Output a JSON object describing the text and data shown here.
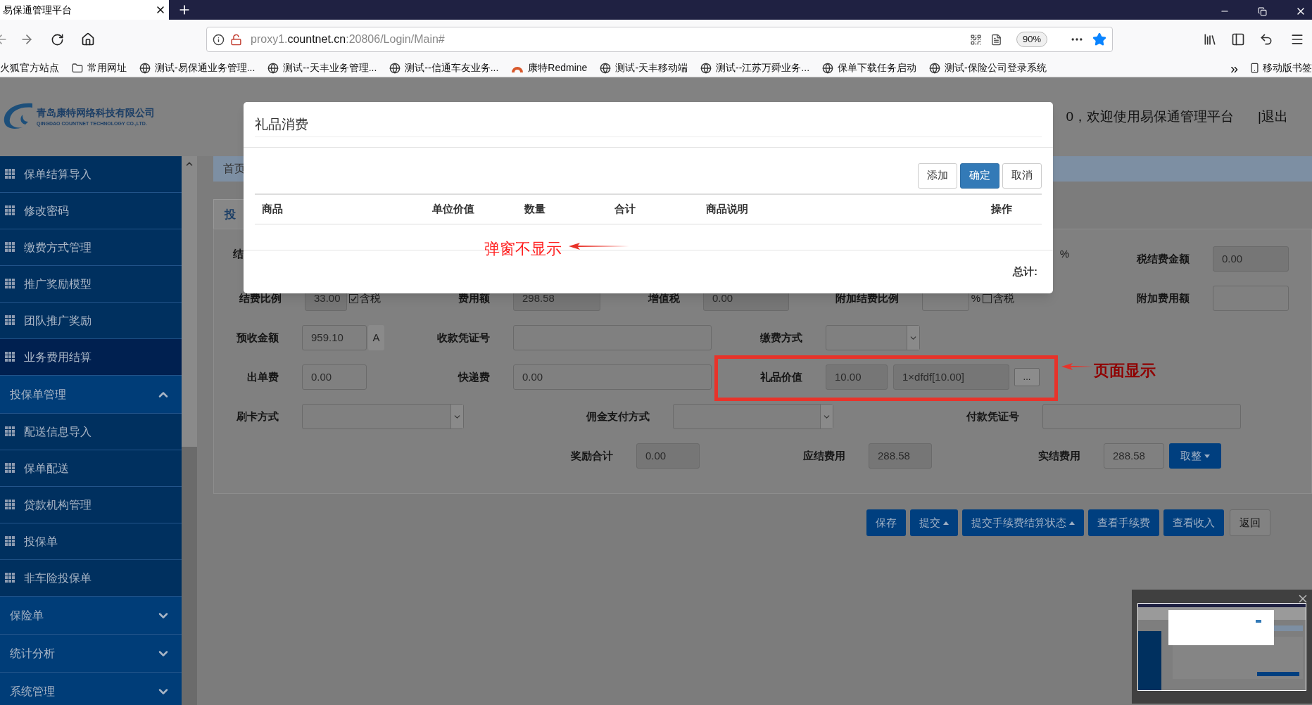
{
  "browser": {
    "tab_title": "易保通管理平台",
    "url_prefix": "proxy1.",
    "url_domain": "countnet.cn",
    "url_path": ":20806/Login/Main#",
    "zoom": "90%",
    "bookmarks": [
      {
        "label": "火狐官方站点",
        "kind": "none"
      },
      {
        "label": "常用网址",
        "kind": "folder"
      },
      {
        "label": "测试-易保通业务管理...",
        "kind": "globe"
      },
      {
        "label": "测试--天丰业务管理...",
        "kind": "globe"
      },
      {
        "label": "测试--信通车友业务...",
        "kind": "globe"
      },
      {
        "label": "康特Redmine",
        "kind": "redmine"
      },
      {
        "label": "测试-天丰移动端",
        "kind": "globe"
      },
      {
        "label": "测试--江苏万舜业务...",
        "kind": "globe"
      },
      {
        "label": "保单下载任务启动",
        "kind": "globe"
      },
      {
        "label": "测试-保险公司登录系统",
        "kind": "globe"
      }
    ],
    "overflow": "»",
    "mobile_bookmarks": "移动版书签"
  },
  "header": {
    "company_name": "青岛康特网络科技有限公司",
    "company_english": "QINGDAO COUNTNET TECHNOLOGY CO.,LTD.",
    "welcome": "0，欢迎使用易保通管理平台",
    "logout": "|退出"
  },
  "sidebar": {
    "items": [
      {
        "label": "保单结算导入",
        "kind": "item",
        "selected": false
      },
      {
        "label": "修改密码",
        "kind": "item",
        "selected": false
      },
      {
        "label": "缴费方式管理",
        "kind": "item",
        "selected": false
      },
      {
        "label": "推广奖励模型",
        "kind": "item",
        "selected": false
      },
      {
        "label": "团队推广奖励",
        "kind": "item",
        "selected": false
      },
      {
        "label": "业务费用结算",
        "kind": "item",
        "selected": true
      },
      {
        "label": "投保单管理",
        "kind": "group",
        "expanded": true
      },
      {
        "label": "配送信息导入",
        "kind": "item",
        "selected": false
      },
      {
        "label": "保单配送",
        "kind": "item",
        "selected": false
      },
      {
        "label": "贷款机构管理",
        "kind": "item",
        "selected": false
      },
      {
        "label": "投保单",
        "kind": "item",
        "selected": false
      },
      {
        "label": "非车险投保单",
        "kind": "item",
        "selected": false
      },
      {
        "label": "保险单",
        "kind": "group",
        "expanded": false
      },
      {
        "label": "统计分析",
        "kind": "group",
        "expanded": false
      },
      {
        "label": "系统管理",
        "kind": "group",
        "expanded": false
      }
    ]
  },
  "breadcrumb": "首页",
  "page_tab": "投",
  "form": {
    "fields": [
      {
        "kind": "label_only",
        "label": "结"
      },
      {
        "kind": "unit",
        "unit": "%"
      },
      {
        "kind": "readonly",
        "label": "税结费金额",
        "value": "0.00"
      },
      {
        "kind": "readonly",
        "label": "结费比例",
        "value": "33.00",
        "checkbox": {
          "label": "含税",
          "checked": true
        }
      },
      {
        "kind": "readonly",
        "label": "费用额",
        "value": "298.58"
      },
      {
        "kind": "readonly",
        "label": "增值税",
        "value": "0.00"
      },
      {
        "kind": "text",
        "label": "附加结费比例",
        "unit": "%",
        "checkbox": {
          "label": "含税",
          "checked": false
        }
      },
      {
        "kind": "text",
        "label": "附加费用额"
      },
      {
        "kind": "text",
        "label": "预收金额",
        "value": "959.10",
        "addon": "A"
      },
      {
        "kind": "text",
        "label": "收款凭证号"
      },
      {
        "kind": "select",
        "label": "缴费方式"
      },
      {
        "kind": "text",
        "label": "出单费",
        "value": "0.00"
      },
      {
        "kind": "text",
        "label": "快递费",
        "value": "0.00"
      },
      {
        "kind": "readonly",
        "label": "礼品价值",
        "value": "10.00",
        "detail": "1×dfdf[10.00]",
        "button": "..."
      },
      {
        "kind": "select",
        "label": "刷卡方式"
      },
      {
        "kind": "select",
        "label": "佣金支付方式"
      },
      {
        "kind": "text",
        "label": "付款凭证号"
      },
      {
        "kind": "readonly",
        "label": "奖励合计",
        "value": "0.00"
      },
      {
        "kind": "readonly",
        "label": "应结费用",
        "value": "288.58"
      },
      {
        "kind": "text",
        "label": "实结费用",
        "value": "288.58",
        "dropdown_button": "取整"
      }
    ]
  },
  "action_buttons": [
    {
      "label": "保存",
      "kind": "primary",
      "dropdown": false
    },
    {
      "label": "提交",
      "kind": "primary",
      "dropdown": true
    },
    {
      "label": "提交手续费结算状态",
      "kind": "primary",
      "dropdown": true
    },
    {
      "label": "查看手续费",
      "kind": "primary",
      "dropdown": false
    },
    {
      "label": "查看收入",
      "kind": "primary",
      "dropdown": false
    },
    {
      "label": "返回",
      "kind": "default",
      "dropdown": false
    }
  ],
  "dialog": {
    "title": "礼品消费",
    "buttons": [
      {
        "label": "添加",
        "kind": "default"
      },
      {
        "label": "确定",
        "kind": "primary"
      },
      {
        "label": "取消",
        "kind": "default"
      }
    ],
    "columns": [
      "商品",
      "单位价值",
      "数量",
      "合计",
      "商品说明",
      "操作"
    ],
    "total_label": "总计:"
  },
  "annotations": [
    {
      "kind": "arrow_note",
      "text": "弹窗不显示"
    },
    {
      "kind": "arrow_note",
      "text": "页面显示"
    },
    {
      "kind": "frame"
    }
  ]
}
